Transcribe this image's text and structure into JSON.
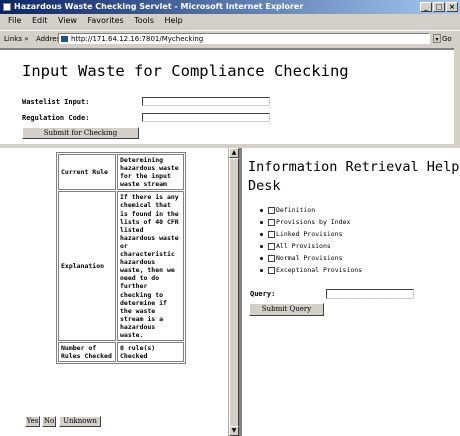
{
  "window": {
    "title": "Hazardous Waste Checking Servlet - Microsoft Internet Explorer",
    "menu": [
      "File",
      "Edit",
      "View",
      "Favorites",
      "Tools",
      "Help"
    ],
    "links_label": "Links »",
    "address_label": "Address",
    "url": "http://171.64.12.16:7801/Mychecking",
    "go_label": "Go"
  },
  "form": {
    "heading": "Input Waste for Compliance Checking",
    "wastelist_label": "Wastelist Input:",
    "regulation_label": "Regulation Code:",
    "wastelist_value": "",
    "regulation_value": "",
    "submit_label": "Submit for Checking"
  },
  "result": {
    "current_rule_label": "Current Rule",
    "current_rule_value": "Determining hazardous waste for the input waste stream",
    "explanation_label": "Explanation",
    "explanation_value": "If there is any chemical that is found in the lists of 40 CFR listed hazardous waste or characteristic hazardous waste, then we need to do further checking to determine if the waste stream is a hazardous waste.",
    "rules_checked_label": "Number of Rules Checked",
    "rules_checked_value": "0 rule(s) Checked",
    "yes_label": "Yes",
    "no_label": "No",
    "unknown_label": "Unknown"
  },
  "help": {
    "title": "Information Retrieval Help Desk",
    "provisions": [
      "Definition",
      "Provisions by Index",
      "Linked Provisions",
      "All Provisions",
      "Normal Provisions",
      "Exceptional Provisions"
    ],
    "query_label": "Query:",
    "query_value": "",
    "submit_label": "Submit Query"
  }
}
